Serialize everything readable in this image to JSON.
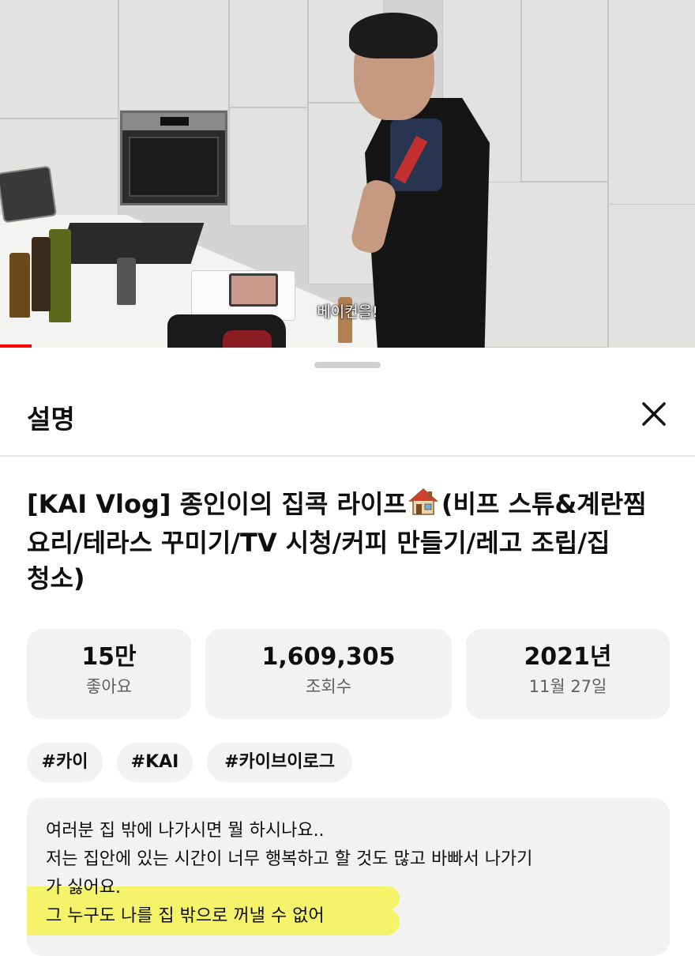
{
  "video": {
    "caption": "베이컨을!",
    "progress_fraction": 0.045,
    "progress_color": "#ff0000"
  },
  "sheet": {
    "title": "설명",
    "close_icon": "close-icon"
  },
  "video_info": {
    "title": "[KAI Vlog] 종인이의 집콕 라이프🏠 (비프 스튜&계란찜 요리/테라스 꾸미기/TV 시청/커피 만들기/레고 조립/집 청소)",
    "title_lines": [
      "[KAI Vlog] 종인이의 집콕 라이프",
      "요리/테라스 꾸미기/TV 시청/커피 만들기/레고 조립/집",
      "청소)"
    ],
    "title_line1_tail": "(비프 스튜&계란찜"
  },
  "stats": {
    "likes_value": "15만",
    "likes_label": "좋아요",
    "views_value": "1,609,305",
    "views_label": "조회수",
    "year_value": "2021년",
    "date_label": "11월 27일"
  },
  "tags": [
    "#카이",
    "#KAI",
    "#카이브이로그"
  ],
  "description": {
    "lines": [
      "여러분 집 밖에 나가시면 뭘 하시나요..",
      "저는 집안에 있는 시간이 너무 행복하고 할 것도 많고 바빠서 나가기",
      "가 싫어요.",
      "그 누구도 나를 집 밖으로 꺼낼 수 없어"
    ],
    "highlight_color": "#f4f36a"
  }
}
